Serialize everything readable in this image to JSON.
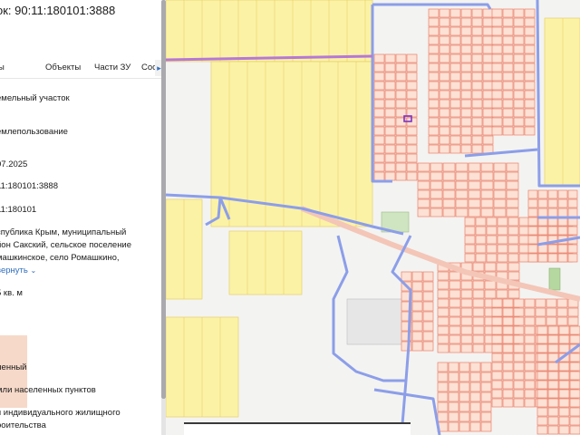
{
  "panel": {
    "title": "ок: 90:11:180101:3888",
    "tabs": [
      "ы",
      "Объекты",
      "Части ЗУ",
      "Соста"
    ],
    "tabs_more_arrow": "▸",
    "rows": {
      "type": "емельный участок",
      "form": "емлепользование",
      "date": "07.2025",
      "cad_number": "11:180101:3888",
      "quarter": "11:180101",
      "address_line1": "спублика Крым, муниципальный",
      "address_line2": "йон Сакский, сельское поселение",
      "address_line3": "машкинское, село Ромашкино,",
      "collapse_link": "вернуть",
      "area": "5 кв. м",
      "status": "ленный",
      "category": "мли населенных пунктов",
      "use_line1": "я индивидуального жилищного",
      "use_line2": "роительства"
    }
  },
  "map": {
    "colors": {
      "background": "#f3f3f1",
      "field_yellow": "#fbf2a6",
      "field_stroke": "#e7c95a",
      "parcel_fill": "#fde1d4",
      "parcel_stroke": "#e8806c",
      "boundary_blue": "#8c9ee9",
      "boundary_purple": "#b678d6",
      "green_area": "#cfe4c0",
      "selected_parcel": "#7b35c6"
    }
  }
}
